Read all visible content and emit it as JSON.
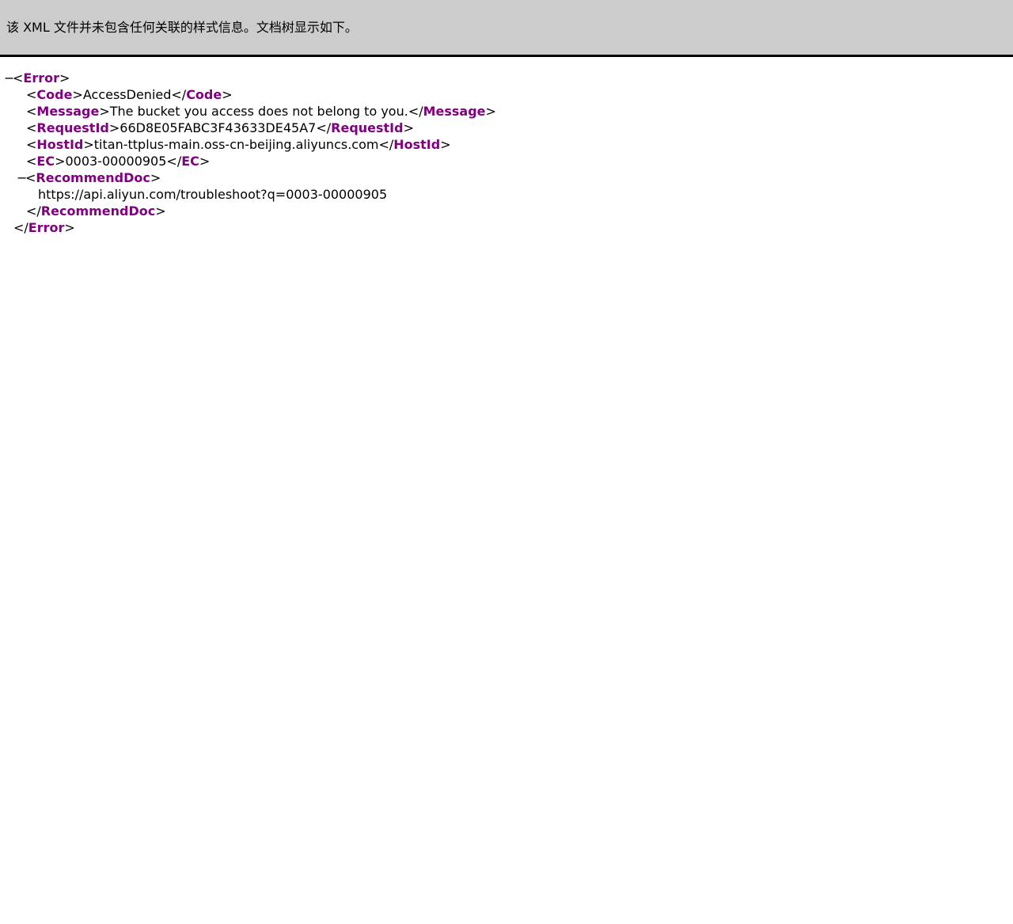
{
  "header": {
    "message": "该 XML 文件并未包含任何关联的样式信息。文档树显示如下。"
  },
  "tree": {
    "toggle_glyph": "−",
    "root": {
      "tag": "Error",
      "children": [
        {
          "tag": "Code",
          "value": "AccessDenied"
        },
        {
          "tag": "Message",
          "value": "The bucket you access does not belong to you."
        },
        {
          "tag": "RequestId",
          "value": "66D8E05FABC3F43633DE45A7"
        },
        {
          "tag": "HostId",
          "value": "titan-ttplus-main.oss-cn-beijing.aliyuncs.com"
        },
        {
          "tag": "EC",
          "value": "0003-00000905"
        }
      ],
      "recommend": {
        "tag": "RecommendDoc",
        "value": "https://api.aliyun.com/troubleshoot?q=0003-00000905"
      }
    }
  },
  "colors": {
    "header_bg": "#cccccc",
    "tag_name": "#800080",
    "text": "#000000"
  }
}
